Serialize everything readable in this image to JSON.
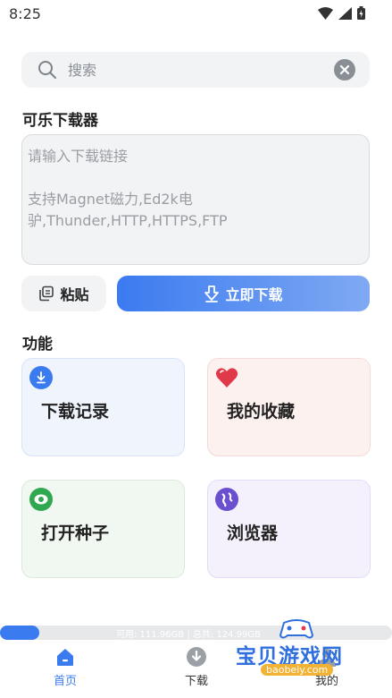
{
  "status_bar": {
    "time": "8:25"
  },
  "search": {
    "placeholder": "搜索"
  },
  "downloader": {
    "title": "可乐下载器",
    "input_placeholder": "请输入下载链接\n\n支持Magnet磁力,Ed2k电驴,Thunder,HTTP,HTTPS,FTP",
    "paste_label": "粘贴",
    "download_label": "立即下载"
  },
  "features": {
    "title": "功能",
    "items": [
      {
        "label": "下载记录",
        "icon": "download-icon",
        "color": "#3b7bf0"
      },
      {
        "label": "我的收藏",
        "icon": "heart-icon",
        "color": "#e0394a"
      },
      {
        "label": "打开种子",
        "icon": "eye-icon",
        "color": "#2fa84f"
      },
      {
        "label": "浏览器",
        "icon": "globe-icon",
        "color": "#6a4fd1"
      }
    ]
  },
  "storage": {
    "text": "可用: 111.96GB | 总共: 124.99GB",
    "used_fraction": 0.1
  },
  "bottom_nav": {
    "items": [
      {
        "label": "首页",
        "icon": "home-icon",
        "active": true
      },
      {
        "label": "下载",
        "icon": "download-circle-icon",
        "active": false
      },
      {
        "label": "我的",
        "icon": "person-icon",
        "active": false
      }
    ]
  },
  "watermark": {
    "title": "宝贝游戏网",
    "sub": "baobeiy.com"
  },
  "colors": {
    "accent": "#3b7bf0",
    "surface": "#f1f3f5"
  }
}
